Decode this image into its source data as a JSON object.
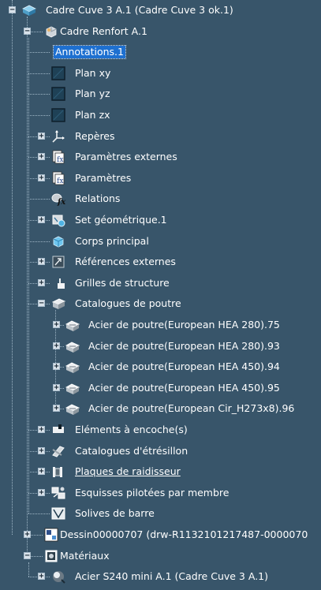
{
  "tree": {
    "nodes": [
      {
        "label": "Cadre Cuve 3 A.1 (Cadre Cuve 3 ok.1)",
        "icon": "product-icon",
        "expander": "minus"
      },
      {
        "label": "Cadre Renfort A.1",
        "icon": "part-icon",
        "expander": "minus"
      },
      {
        "label": "Annotations.1",
        "icon": "",
        "expander": "",
        "selected": true
      },
      {
        "label": "Plan xy",
        "icon": "plane-icon",
        "expander": ""
      },
      {
        "label": "Plan yz",
        "icon": "plane-icon",
        "expander": ""
      },
      {
        "label": "Plan zx",
        "icon": "plane-icon",
        "expander": ""
      },
      {
        "label": "Repères",
        "icon": "axis-system-icon",
        "expander": "plus"
      },
      {
        "label": "Paramètres externes",
        "icon": "parameters-icon",
        "expander": "plus"
      },
      {
        "label": "Paramètres",
        "icon": "parameters-icon",
        "expander": "plus"
      },
      {
        "label": "Relations",
        "icon": "relations-icon",
        "expander": ""
      },
      {
        "label": "Set géométrique.1",
        "icon": "geometrical-set-icon",
        "expander": "plus"
      },
      {
        "label": "Corps principal",
        "icon": "body-icon",
        "expander": ""
      },
      {
        "label": "Références externes",
        "icon": "external-references-icon",
        "expander": "plus"
      },
      {
        "label": "Grilles de structure",
        "icon": "grid-icon",
        "expander": "plus"
      },
      {
        "label": "Catalogues de poutre",
        "icon": "beam-catalog-icon",
        "expander": "minus"
      },
      {
        "label": "Acier de poutre(European HEA 280).75",
        "icon": "beam-icon",
        "expander": "plus"
      },
      {
        "label": "Acier de poutre(European HEA 280).93",
        "icon": "beam-icon",
        "expander": "plus"
      },
      {
        "label": "Acier de poutre(European HEA 450).94",
        "icon": "beam-icon",
        "expander": "plus"
      },
      {
        "label": "Acier de poutre(European HEA 450).95",
        "icon": "beam-icon",
        "expander": "plus"
      },
      {
        "label": "Acier de poutre(European Cir_H273x8).96",
        "icon": "beam-icon",
        "expander": "plus"
      },
      {
        "label": "Eléments à encoche(s)",
        "icon": "notch-icon",
        "expander": "plus"
      },
      {
        "label": "Catalogues d'étrésillon",
        "icon": "strut-catalog-icon",
        "expander": "plus"
      },
      {
        "label": "Plaques de raidisseur",
        "icon": "stiffener-plate-icon",
        "expander": "plus",
        "underline": true
      },
      {
        "label": "Esquisses pilotées par membre",
        "icon": "sketch-icon",
        "expander": "plus"
      },
      {
        "label": "Solives de barre",
        "icon": "joist-icon",
        "expander": ""
      },
      {
        "label": "Dessin00000707 (drw-R1132101217487-0000070",
        "icon": "drawing-icon",
        "expander": "plus"
      },
      {
        "label": "Matériaux",
        "icon": "materials-icon",
        "expander": "minus"
      },
      {
        "label": "Acier S240 mini A.1 (Cadre Cuve 3 A.1)",
        "icon": "material-icon",
        "expander": "plus"
      }
    ]
  }
}
